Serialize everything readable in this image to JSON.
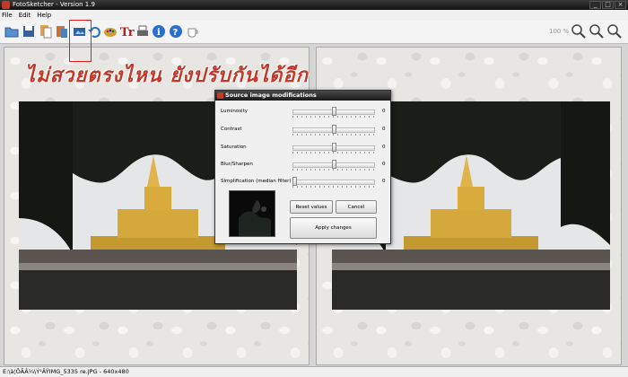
{
  "window": {
    "title": "FotoSketcher - Version 1.9"
  },
  "menu": [
    "File",
    "Edit",
    "Help"
  ],
  "toolbar": {
    "zoom": "100 %"
  },
  "overlay": {
    "text": "ไม่สวยตรงไหน ยังปรับกันได้อีก"
  },
  "status": {
    "text": "E:\\à¦ÔÃÂ¼\\Ý¹ÃŸIMG_5335 re.JPG - 640x480"
  },
  "dialog": {
    "title": "Source image modifications",
    "sliders": [
      {
        "label": "Luminosity",
        "value": "0",
        "level": 0.5
      },
      {
        "label": "Contrast",
        "value": "0",
        "level": 0.5
      },
      {
        "label": "Saturation",
        "value": "0",
        "level": 0.5
      },
      {
        "label": "Blur/Sharpen",
        "value": "0",
        "level": 0.5
      },
      {
        "label": "Simplification (median filter)",
        "value": "0",
        "level": 0.0
      }
    ],
    "reset_label": "Reset values",
    "cancel_label": "Cancel",
    "apply_label": "Apply changes"
  },
  "colors": {
    "accent": "#c0392b",
    "highlight": "#e02020"
  }
}
